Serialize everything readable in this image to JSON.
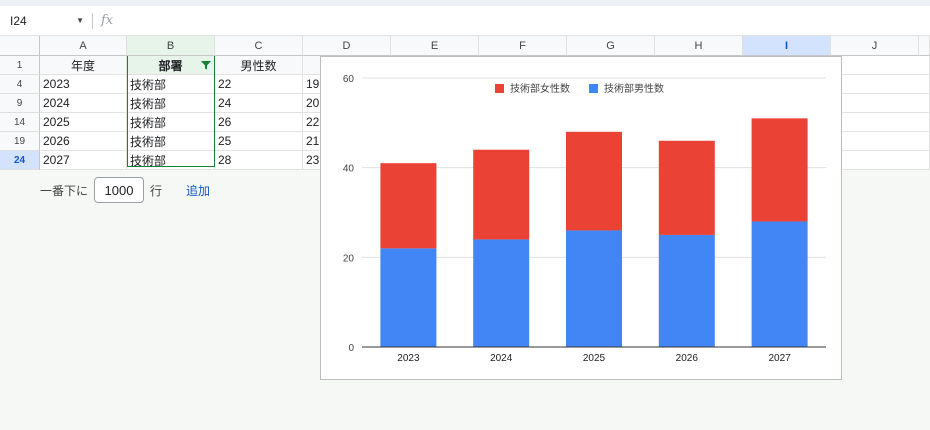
{
  "formula_bar": {
    "cell_ref": "I24",
    "fx": "fx"
  },
  "columns": [
    "A",
    "B",
    "C",
    "D",
    "E",
    "F",
    "G",
    "H",
    "I",
    "J"
  ],
  "header_row": {
    "row_num": "1",
    "a": "年度",
    "b": "部署",
    "c": "男性数"
  },
  "rows": [
    {
      "num": "4",
      "a": "2023",
      "b": "技術部",
      "c": "22",
      "d": "19"
    },
    {
      "num": "9",
      "a": "2024",
      "b": "技術部",
      "c": "24",
      "d": "20"
    },
    {
      "num": "14",
      "a": "2025",
      "b": "技術部",
      "c": "26",
      "d": "22"
    },
    {
      "num": "19",
      "a": "2026",
      "b": "技術部",
      "c": "25",
      "d": "21"
    },
    {
      "num": "24",
      "a": "2027",
      "b": "技術部",
      "c": "28",
      "d": "23"
    }
  ],
  "add_rows": {
    "prefix": "一番下に",
    "value": "1000",
    "suffix": "行",
    "button": "追加"
  },
  "colors": {
    "female": "#ea4335",
    "male": "#4285f4",
    "selection": "#d3e3fd",
    "filter_green": "#188038"
  },
  "chart_data": {
    "type": "bar",
    "stacked": true,
    "categories": [
      "2023",
      "2024",
      "2025",
      "2026",
      "2027"
    ],
    "series": [
      {
        "name": "技術部男性数",
        "values": [
          22,
          24,
          26,
          25,
          28
        ],
        "color": "#4285f4"
      },
      {
        "name": "技術部女性数",
        "values": [
          19,
          20,
          22,
          21,
          23
        ],
        "color": "#ea4335"
      }
    ],
    "legend_order": [
      "技術部女性数",
      "技術部男性数"
    ],
    "ylim": [
      0,
      60
    ],
    "yticks": [
      "0",
      "20",
      "40",
      "60"
    ],
    "grid": true,
    "legend_position": "top"
  }
}
